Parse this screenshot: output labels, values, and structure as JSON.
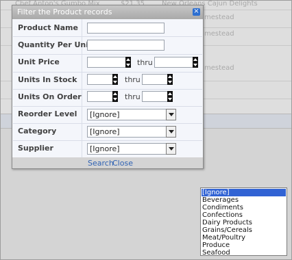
{
  "background": {
    "row1": {
      "product": "Chef Anton's Gumbo Mix",
      "price": "$21.35",
      "supplier": "New Orleans Cajun Delights"
    },
    "row2": {
      "supplier": "mestead"
    },
    "row3": {
      "supplier": "mestead"
    },
    "row4": {
      "supplier": "mestead"
    }
  },
  "dialog": {
    "title": "Filter the Product records",
    "close_glyph": "×",
    "fields": {
      "product_name": {
        "label": "Product Name",
        "value": ""
      },
      "quantity_per_unit": {
        "label": "Quantity Per Unit",
        "value": ""
      },
      "unit_price": {
        "label": "Unit Price",
        "from": "",
        "thru_label": "thru",
        "to": ""
      },
      "units_in_stock": {
        "label": "Units In Stock",
        "from": "",
        "thru_label": "thru",
        "to": ""
      },
      "units_on_order": {
        "label": "Units On Order",
        "from": "",
        "thru_label": "thru",
        "to": ""
      },
      "reorder_level": {
        "label": "Reorder Level",
        "value": "[Ignore]"
      },
      "category": {
        "label": "Category",
        "value": "[Ignore]"
      },
      "supplier": {
        "label": "Supplier",
        "value": "[Ignore]"
      }
    },
    "search_label": "Search",
    "close_label": "Close"
  },
  "category_list": {
    "options": [
      "[Ignore]",
      "Beverages",
      "Condiments",
      "Confections",
      "Dairy Products",
      "Grains/Cereals",
      "Meat/Poultry",
      "Produce",
      "Seafood"
    ],
    "selected_index": 0
  },
  "colors": {
    "accent": "#2f62b3",
    "selection": "#3163d4",
    "close_button": "#2d6fd1"
  }
}
